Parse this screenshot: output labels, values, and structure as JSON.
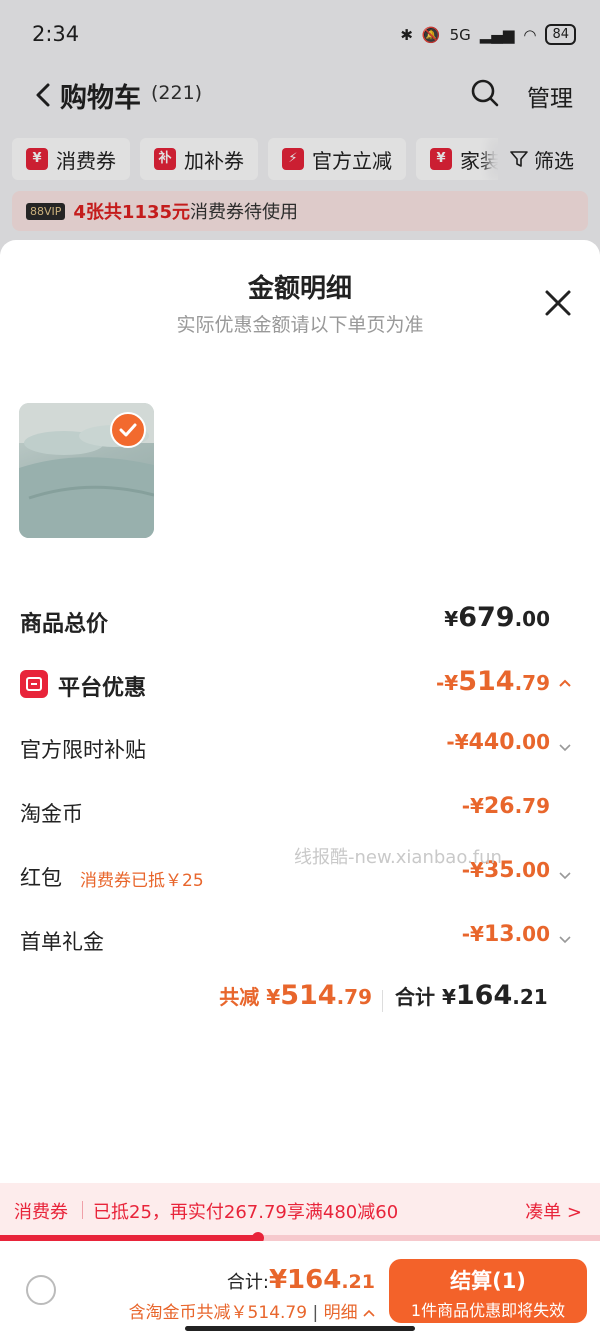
{
  "status_bar": {
    "time": "2:34",
    "network": "5G",
    "battery": "84"
  },
  "nav": {
    "title": "购物车",
    "count": "(221)",
    "manage": "管理"
  },
  "chips": [
    {
      "icon": "¥",
      "label": "消费券"
    },
    {
      "icon": "补",
      "label": "加补券"
    },
    {
      "icon": "⚡",
      "label": "官方立减"
    },
    {
      "icon": "¥",
      "label": "家装"
    }
  ],
  "filter_label": "筛选",
  "vip": {
    "badge": "88VIP",
    "highlight": "4张共1135元",
    "rest": "消费券待使用"
  },
  "sheet": {
    "title": "金额明细",
    "subtitle": "实际优惠金额请以下单页为准",
    "rows": {
      "total": {
        "label": "商品总价",
        "amount": "679",
        "cents": ".00",
        "currency": "¥"
      },
      "platform": {
        "label": "平台优惠",
        "amount": "514",
        "cents": ".79",
        "prefix": "-¥"
      },
      "official": {
        "label": "官方限时补贴",
        "amount": "440",
        "cents": ".00",
        "prefix": "-¥"
      },
      "coins": {
        "label": "淘金币",
        "amount": "26",
        "cents": ".79",
        "prefix": "-¥"
      },
      "redpacket": {
        "label": "红包",
        "note": "消费券已抵￥25",
        "amount": "35",
        "cents": ".00",
        "prefix": "-¥"
      },
      "firstorder": {
        "label": "首单礼金",
        "amount": "13",
        "cents": ".00",
        "prefix": "-¥"
      }
    },
    "summary": {
      "saved_label": "共减",
      "saved_amount": "514",
      "saved_cents": ".79",
      "sum_label": "合计",
      "sum_amount": "164",
      "sum_cents": ".21",
      "currency": "¥"
    },
    "watermark": "线报酷-new.xianbao.fun"
  },
  "coupon_strip": {
    "label": "消费券",
    "text": "已抵25，再实付267.79享满480减60",
    "action": "凑单 >",
    "progress": 0.43
  },
  "bottom_bar": {
    "total_label": "合计:",
    "currency": "¥",
    "amount": "164",
    "cents": ".21",
    "detail_text": "含淘金币共减￥514.79",
    "detail_link": "明细",
    "checkout_label": "结算(1)",
    "checkout_sub": "1件商品优惠即将失效"
  },
  "colors": {
    "accent_orange": "#f3622a",
    "accent_red": "#e8243a",
    "amount_orange": "#e8662c"
  }
}
